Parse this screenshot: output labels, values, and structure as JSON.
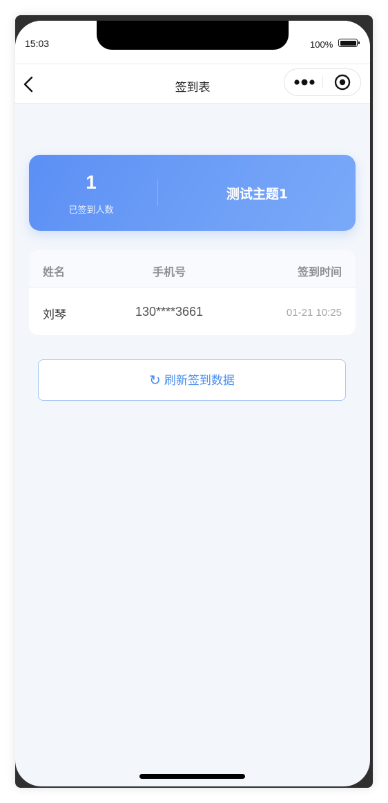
{
  "status_bar": {
    "time": "15:03",
    "battery": "100%"
  },
  "nav": {
    "title": "签到表",
    "back_icon": "chevron-left-icon",
    "more_icon": "more-dots-icon",
    "close_icon": "target-circle-icon"
  },
  "summary": {
    "count": "1",
    "count_label": "已签到人数",
    "topic": "测试主题1"
  },
  "table": {
    "headers": [
      "姓名",
      "手机号",
      "签到时间"
    ],
    "rows": [
      {
        "name": "刘琴",
        "phone": "130****3661",
        "time": "01-21 10:25"
      }
    ]
  },
  "refresh_button": {
    "icon": "↻",
    "label": "刷新签到数据"
  },
  "colors": {
    "accent": "#4b8ef0",
    "card_gradient_start": "#5b8ff4",
    "card_gradient_end": "#7aa9f8",
    "page_background": "#f3f6fb"
  }
}
